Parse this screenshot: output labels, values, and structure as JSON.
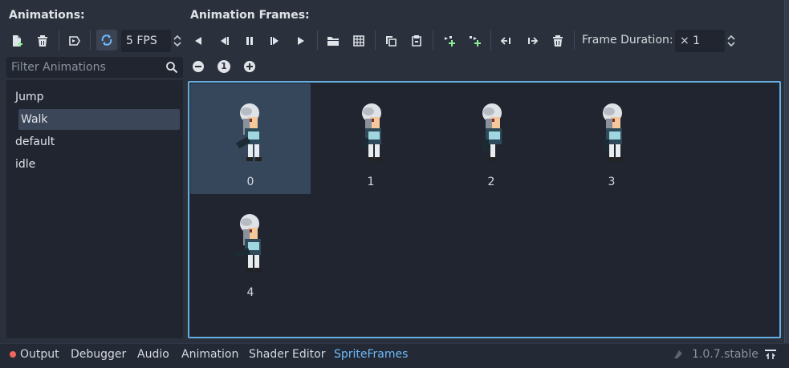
{
  "animations_panel": {
    "title": "Animations:",
    "fps_value": "5 FPS",
    "filter_placeholder": "Filter Animations",
    "items": [
      "Jump",
      "Walk",
      "default",
      "idle"
    ],
    "selected": "Walk"
  },
  "frames_panel": {
    "title": "Animation Frames:",
    "frame_duration_label": "Frame Duration:",
    "frame_duration_value": "× 1",
    "zoom_reset": "1",
    "frames": [
      {
        "index": "0",
        "selected": true
      },
      {
        "index": "1",
        "selected": false
      },
      {
        "index": "2",
        "selected": false
      },
      {
        "index": "3",
        "selected": false
      },
      {
        "index": "4",
        "selected": false
      }
    ]
  },
  "bottom_tabs": {
    "output": "Output",
    "debugger": "Debugger",
    "audio": "Audio",
    "animation": "Animation",
    "shader_editor": "Shader Editor",
    "sprite_frames": "SpriteFrames",
    "active": "SpriteFrames"
  },
  "version": "1.0.7.stable",
  "colors": {
    "accent": "#66aee0",
    "active_tab": "#70bafa",
    "selection": "#36475c",
    "error_dot": "#f3655f"
  },
  "icons": {
    "new_animation": "new-animation-icon",
    "delete_animation": "delete-animation-icon",
    "autoplay": "autoplay-icon",
    "loop": "loop-icon",
    "play_backwards": "play-backwards-icon",
    "play_backwards_from_end": "play-backwards-from-end-icon",
    "pause": "pause-icon",
    "play_from_start": "play-from-start-icon",
    "play": "play-icon",
    "load_frames": "folder-icon",
    "load_from_sheet": "grid-icon",
    "copy": "copy-icon",
    "paste": "paste-icon",
    "insert_before": "insert-before-icon",
    "insert_after": "insert-after-icon",
    "move_left": "move-left-icon",
    "move_right": "move-right-icon",
    "delete_frame": "delete-frame-icon",
    "zoom_out": "zoom-out-icon",
    "zoom_reset": "zoom-reset-icon",
    "zoom_in": "zoom-in-icon",
    "search": "search-icon",
    "pin": "pin-panel-icon"
  }
}
